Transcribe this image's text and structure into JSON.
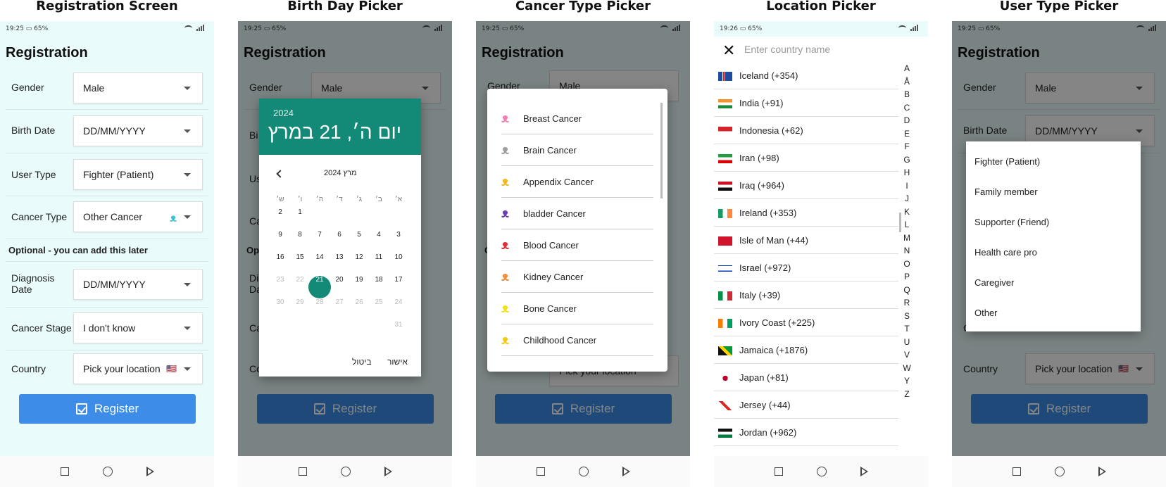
{
  "panel_titles": {
    "registration": "Registration Screen",
    "birthday": "Birth Day Picker",
    "cancer": "Cancer Type Picker",
    "location": "Location Picker",
    "usertype": "User Type Picker"
  },
  "status": {
    "time_a": "19:25",
    "time_b": "19:26",
    "battery": "65%"
  },
  "form": {
    "title": "Registration",
    "gender_label": "Gender",
    "gender_value": "Male",
    "birth_label": "Birth Date",
    "birth_value": "DD/MM/YYYY",
    "usertype_label": "User Type",
    "usertype_value": "Fighter (Patient)",
    "cancer_label": "Cancer Type",
    "cancer_value": "Other Cancer",
    "optional_note": "Optional - you can add this later",
    "diag_label_1": "Diagnosis",
    "diag_label_2": "Date",
    "diag_value": "DD/MM/YYYY",
    "stage_label": "Cancer Stage",
    "stage_value": "I don't know",
    "country_label": "Country",
    "country_value": "Pick your location",
    "register_label": "Register",
    "bg_fragments": {
      "us": "Us",
      "ca": "Ca",
      "bi": "Bi",
      "op": "Op",
      "di": "Di",
      "da": "Da",
      "co": "Co",
      "c": "C",
      "c2": "C"
    }
  },
  "datepicker": {
    "year": "2024",
    "full_date": "יום ה׳, 21 במרץ",
    "month_label": "מרץ 2024",
    "weekdays": [
      "א׳",
      "ב׳",
      "ג׳",
      "ד׳",
      "ה׳",
      "ו׳",
      "ש׳"
    ],
    "selected_day": "21",
    "days": [
      "1",
      "2",
      "3",
      "4",
      "5",
      "6",
      "7",
      "8",
      "9",
      "10",
      "11",
      "12",
      "13",
      "14",
      "15",
      "16",
      "17",
      "18",
      "19",
      "20",
      "21",
      "22",
      "23",
      "24",
      "25",
      "26",
      "27",
      "28",
      "29",
      "30",
      "31"
    ],
    "cancel_label": "ביטול",
    "ok_label": "אישור"
  },
  "cancer_types": [
    {
      "name": "Breast Cancer",
      "color": "#f07fb3"
    },
    {
      "name": "Brain Cancer",
      "color": "#9e9e9e"
    },
    {
      "name": "Appendix Cancer",
      "color": "#f2b620"
    },
    {
      "name": "bladder Cancer",
      "color": "#6b3fb5"
    },
    {
      "name": "Blood Cancer",
      "color": "#d9353a"
    },
    {
      "name": "Kidney Cancer",
      "color": "#f28a3a"
    },
    {
      "name": "Bone Cancer",
      "color": "#f2e020"
    },
    {
      "name": "Childhood Cancer",
      "color": "#f2c820"
    }
  ],
  "location": {
    "search_placeholder": "Enter country name",
    "countries": [
      {
        "name": "Iceland (+354)",
        "flag": "iceland"
      },
      {
        "name": "India (+91)",
        "flag": "india"
      },
      {
        "name": "Indonesia (+62)",
        "flag": "indonesia"
      },
      {
        "name": "Iran (+98)",
        "flag": "iran"
      },
      {
        "name": "Iraq (+964)",
        "flag": "iraq"
      },
      {
        "name": "Ireland (+353)",
        "flag": "ireland"
      },
      {
        "name": "Isle of Man (+44)",
        "flag": "isle-of-man"
      },
      {
        "name": "Israel (+972)",
        "flag": "israel"
      },
      {
        "name": "Italy (+39)",
        "flag": "italy"
      },
      {
        "name": "Ivory Coast (+225)",
        "flag": "ivory-coast"
      },
      {
        "name": "Jamaica (+1876)",
        "flag": "jamaica"
      },
      {
        "name": "Japan (+81)",
        "flag": "japan"
      },
      {
        "name": "Jersey (+44)",
        "flag": "jersey"
      },
      {
        "name": "Jordan (+962)",
        "flag": "jordan"
      }
    ],
    "alphabet": [
      "A",
      "Å",
      "B",
      "C",
      "D",
      "E",
      "F",
      "G",
      "H",
      "I",
      "J",
      "K",
      "L",
      "M",
      "N",
      "O",
      "P",
      "Q",
      "R",
      "S",
      "T",
      "U",
      "V",
      "W",
      "Y",
      "Z"
    ]
  },
  "user_types": [
    "Fighter (Patient)",
    "Family member",
    "Supporter (Friend)",
    "Health care pro",
    "Caregiver",
    "Other"
  ],
  "colors": {
    "accent": "#138a78",
    "button": "#3d8de8",
    "background": "#eafbfb",
    "ribbon_other": "#3dc4d0"
  }
}
